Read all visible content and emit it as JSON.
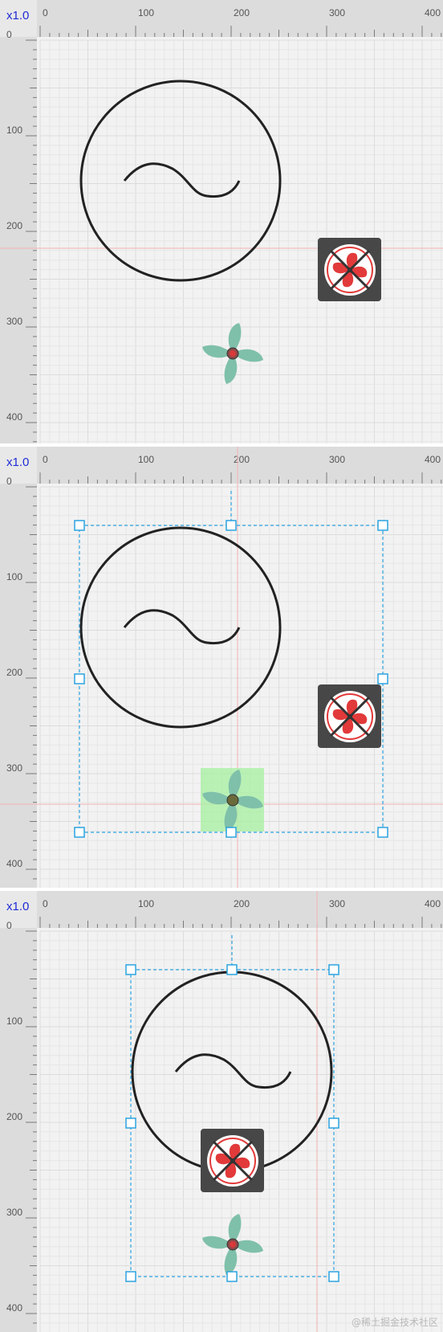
{
  "zoom_label": "x1.0",
  "ruler": {
    "x_ticks": [
      "0",
      "100",
      "200",
      "300",
      "400"
    ],
    "y_ticks": [
      "0",
      "100",
      "200",
      "300",
      "400"
    ]
  },
  "scenes": [
    {
      "name": "editor-view-initial",
      "selection": false
    },
    {
      "name": "editor-view-selecting",
      "selection": true
    },
    {
      "name": "editor-view-aligned",
      "selection": true
    }
  ],
  "icons": {
    "ac_source": "ac-power-source-icon",
    "exhaust_fan": "exhaust-fan-icon",
    "ceiling_fan": "ceiling-fan-icon"
  },
  "colors": {
    "zoom_label": "#1f2bd6",
    "selection": "#2ba3e0",
    "guide_line": "#f3a0a0",
    "hover_highlight": "#a6f0a0",
    "fan_blade_green": "#7fc0aa",
    "fan_blade_red": "#e23a3a"
  },
  "watermark": "@稀土掘金技术社区"
}
